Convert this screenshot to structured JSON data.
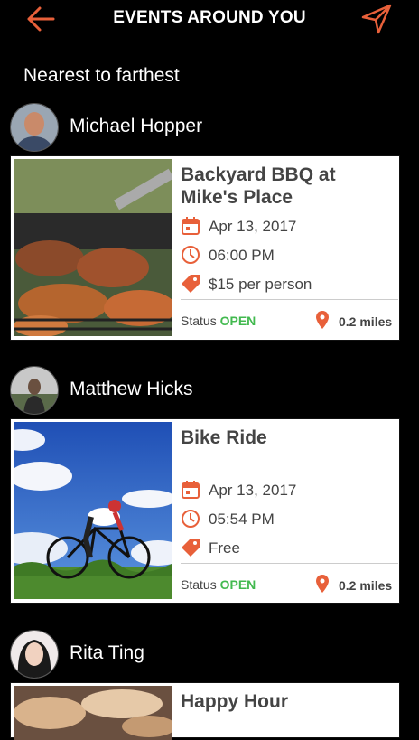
{
  "header": {
    "title": "EVENTS AROUND YOU",
    "back_icon": "back-arrow-icon",
    "send_icon": "send-icon"
  },
  "sort_label": "Nearest to farthest",
  "colors": {
    "accent": "#e8603a",
    "status_open": "#42b94f",
    "background": "#000000"
  },
  "events": [
    {
      "host": "Michael Hopper",
      "title": "Backyard BBQ at Mike's Place",
      "date": "Apr 13, 2017",
      "time": "06:00 PM",
      "price": "$15 per person",
      "status_label": "Status",
      "status_value": "OPEN",
      "distance": "0.2 miles"
    },
    {
      "host": "Matthew Hicks",
      "title": "Bike Ride",
      "date": "Apr 13, 2017",
      "time": "05:54 PM",
      "price": "Free",
      "status_label": "Status",
      "status_value": "OPEN",
      "distance": "0.2 miles"
    },
    {
      "host": "Rita Ting",
      "title": "Happy Hour"
    }
  ]
}
